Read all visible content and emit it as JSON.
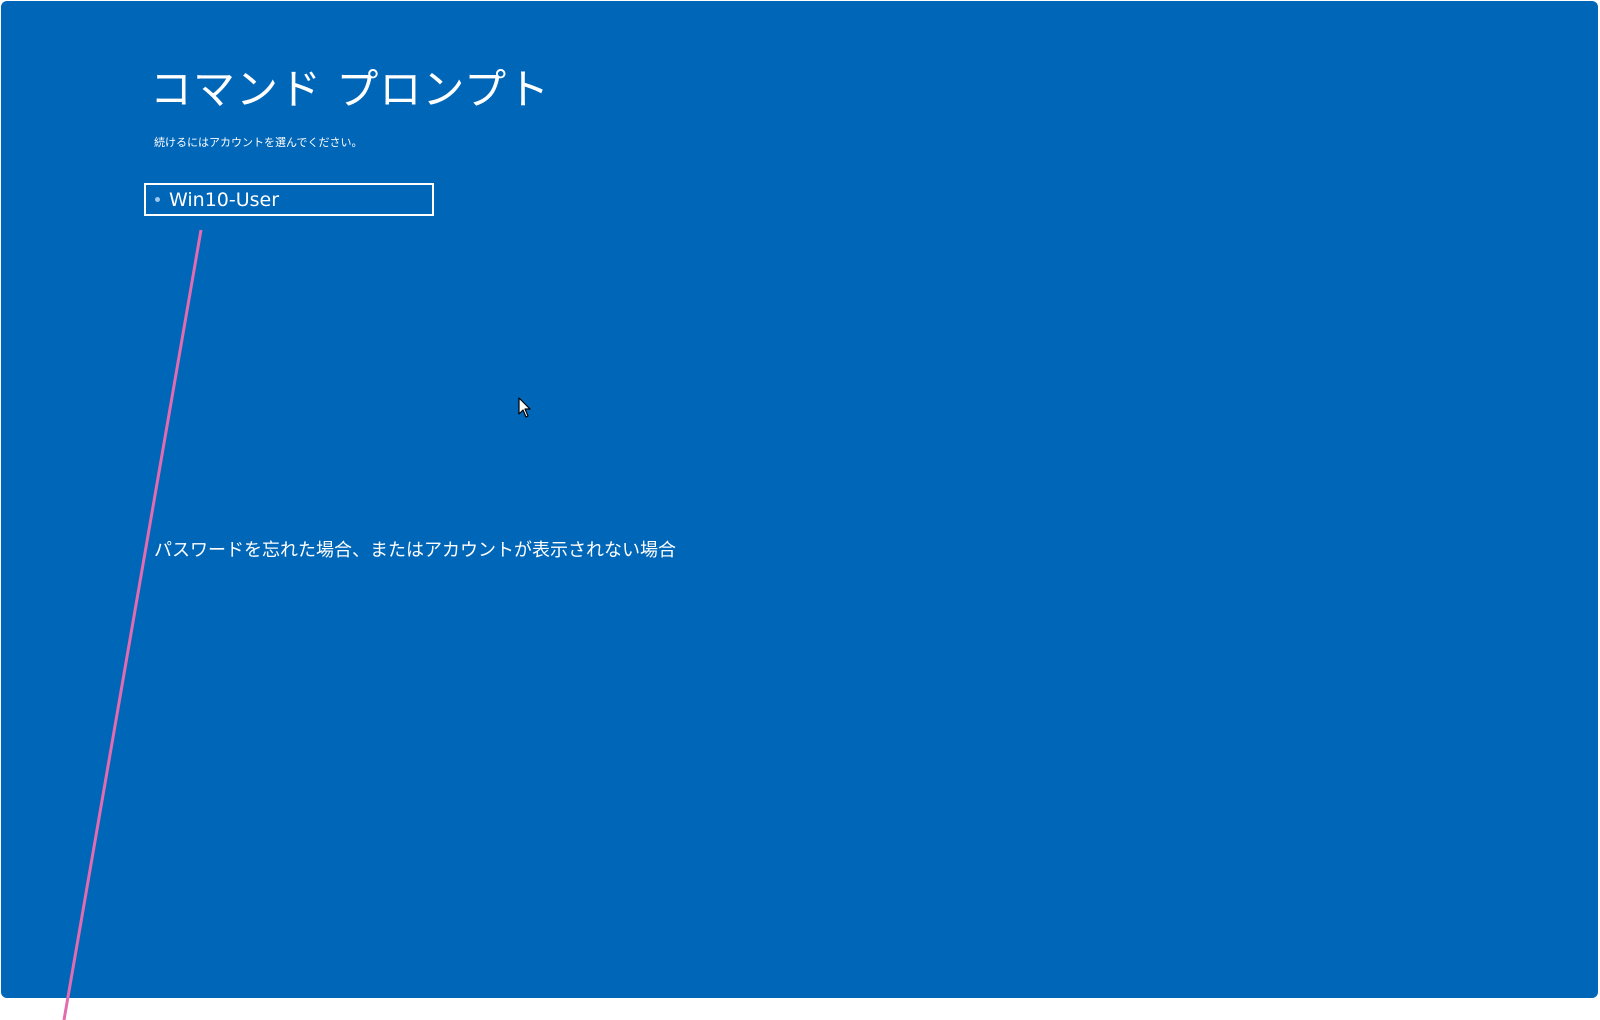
{
  "screen": {
    "title": "コマンド プロンプト",
    "subtitle": "続けるにはアカウントを選んでください。",
    "accounts": [
      {
        "name": "Win10-User"
      }
    ],
    "forgot_link": "パスワードを忘れた場合、またはアカウントが表示されない場合"
  },
  "colors": {
    "background": "#0066b8",
    "text": "#ffffff",
    "annotation_line": "#e36bb0"
  },
  "icons": {
    "pointer": "mouse-pointer-icon",
    "account_marker": "dot-icon"
  }
}
